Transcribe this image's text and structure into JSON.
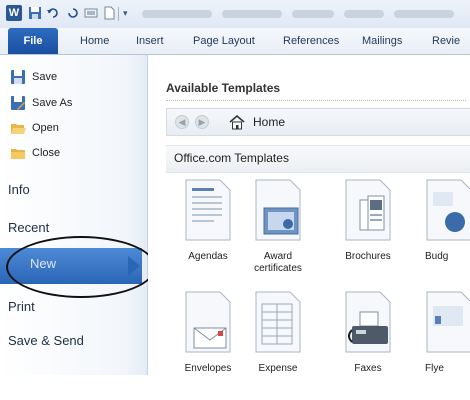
{
  "ribbon": {
    "tabs": [
      "File",
      "Home",
      "Insert",
      "Page Layout",
      "References",
      "Mailings",
      "Revie"
    ]
  },
  "sidebar": {
    "small_commands": [
      {
        "label": "Save",
        "icon": "save-icon"
      },
      {
        "label": "Save As",
        "icon": "save-as-icon"
      },
      {
        "label": "Open",
        "icon": "open-folder-icon"
      },
      {
        "label": "Close",
        "icon": "close-folder-icon"
      }
    ],
    "items": [
      "Info",
      "Recent",
      "New",
      "Print",
      "Save & Send"
    ],
    "selected": "New"
  },
  "main": {
    "heading": "Available Templates",
    "nav_home": "Home",
    "section": "Office.com Templates",
    "templates_row1": [
      "Agendas",
      "Award certificates",
      "Brochures",
      "Budg"
    ],
    "templates_row2": [
      "Envelopes",
      "Expense",
      "Faxes",
      "Flye"
    ]
  },
  "colors": {
    "file_tab": "#1b4fa0",
    "selected_band": "#2a66b6",
    "annotation_ellipse": "#111111"
  }
}
